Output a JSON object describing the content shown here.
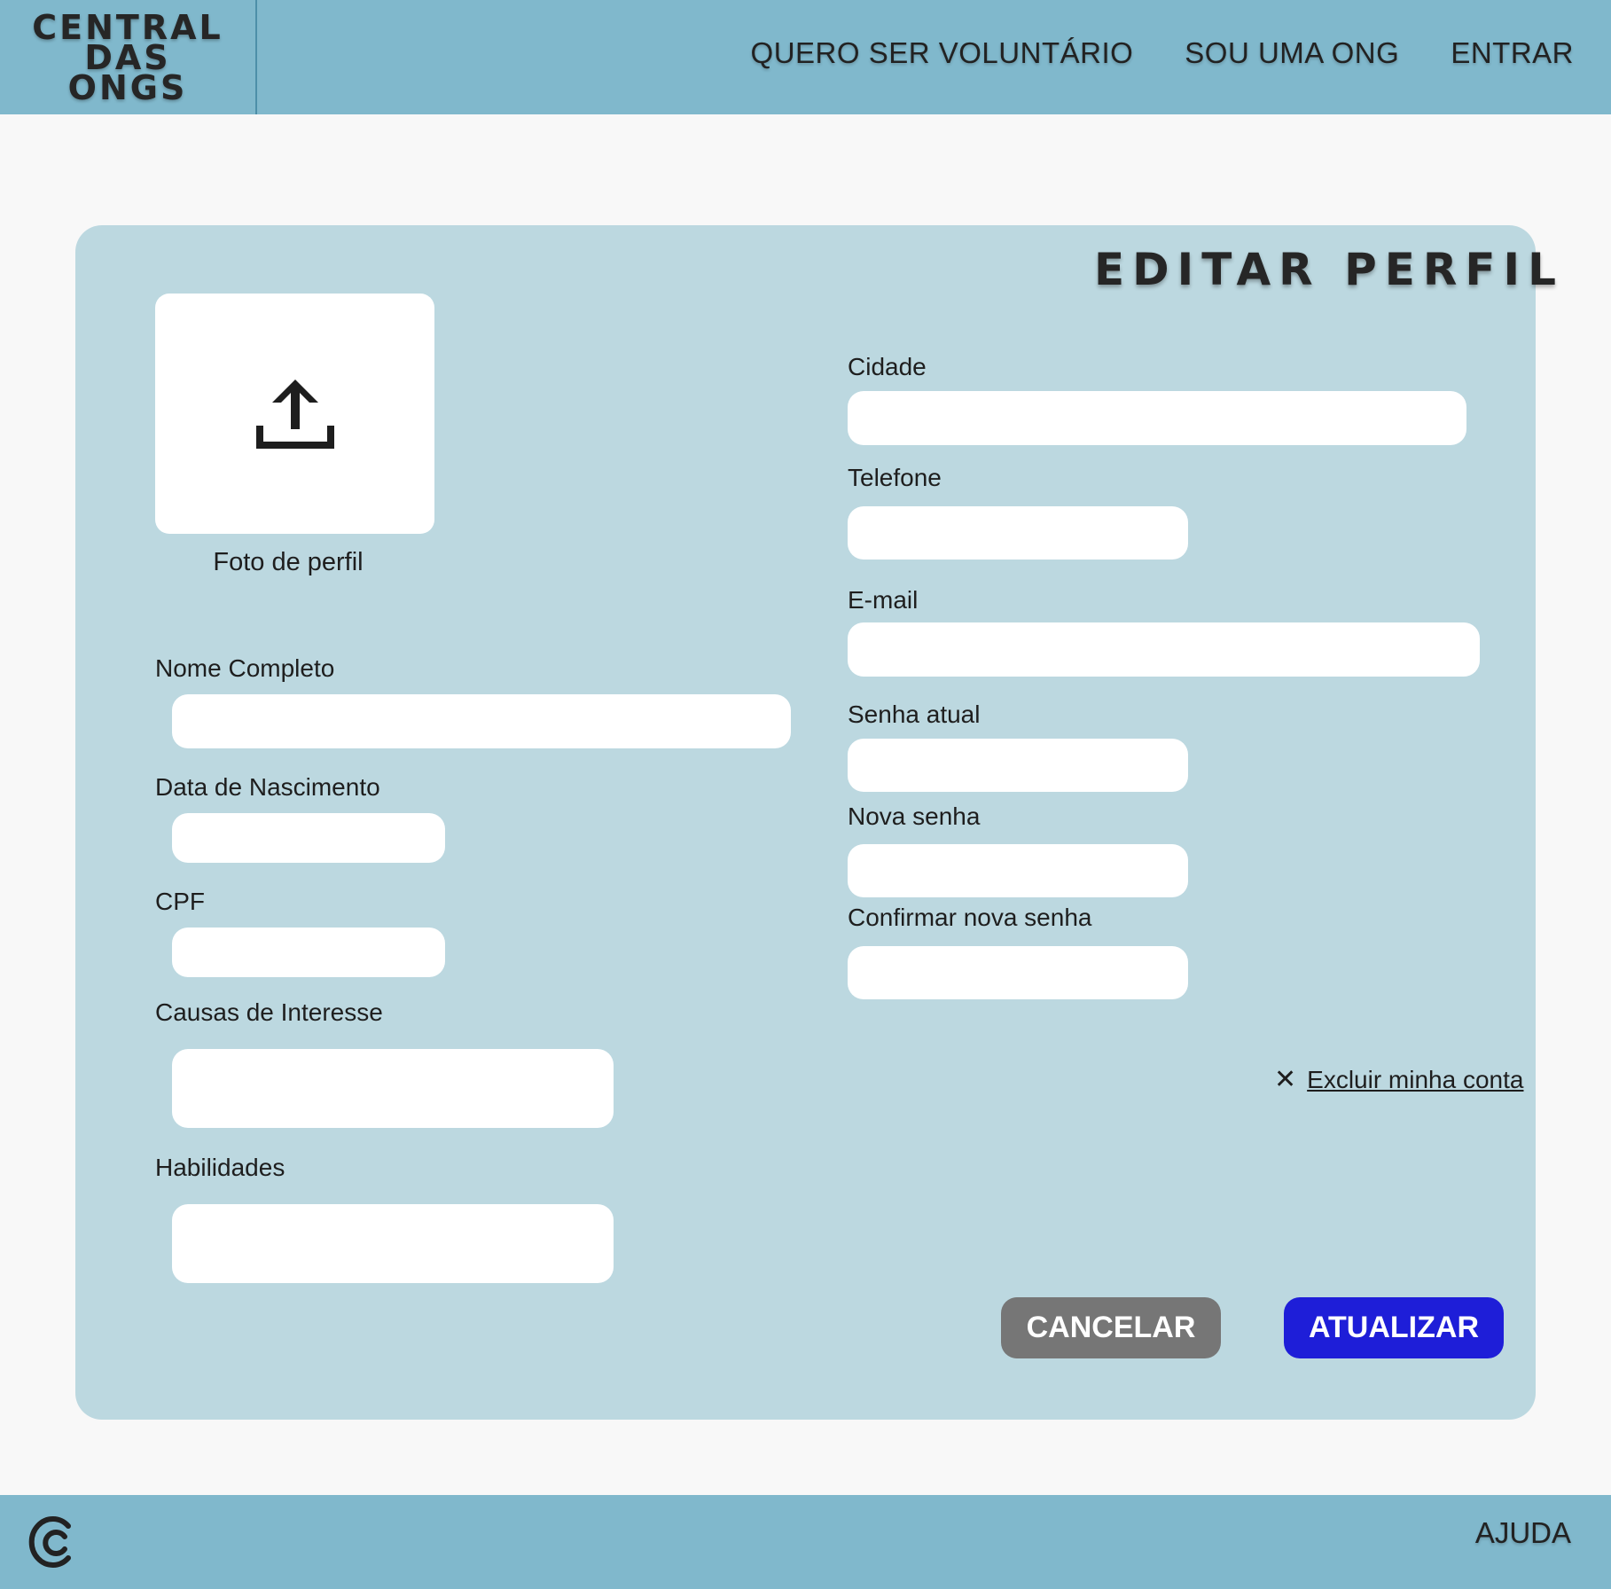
{
  "header": {
    "logo_lines": [
      "CENTRAL",
      "DAS",
      "ONGS"
    ],
    "nav": [
      "QUERO SER VOLUNTÁRIO",
      "SOU UMA ONG",
      "ENTRAR"
    ]
  },
  "form": {
    "title": "EDITAR PERFIL",
    "photo_label": "Foto de perfil",
    "photo_icon": "upload-icon",
    "left_fields": [
      {
        "label": "Nome Completo",
        "value": ""
      },
      {
        "label": "Data de Nascimento",
        "value": ""
      },
      {
        "label": "CPF",
        "value": ""
      },
      {
        "label": "Causas de Interesse",
        "value": ""
      },
      {
        "label": "Habilidades",
        "value": ""
      }
    ],
    "right_fields": [
      {
        "label": "Cidade",
        "value": ""
      },
      {
        "label": "Telefone",
        "value": ""
      },
      {
        "label": "E-mail",
        "value": ""
      },
      {
        "label": "Senha atual",
        "value": ""
      },
      {
        "label": "Nova senha",
        "value": ""
      },
      {
        "label": "Confirmar nova senha",
        "value": ""
      }
    ],
    "delete_account": "Excluir minha conta",
    "cancel_label": "CANCELAR",
    "update_label": "ATUALIZAR"
  },
  "footer": {
    "help": "AJUDA",
    "logo_icon": "brand-c-icon"
  },
  "colors": {
    "header_bg": "#80b8cc",
    "card_bg": "#bcd8e0",
    "cancel_button": "#767676",
    "update_button": "#1e1ed8"
  }
}
